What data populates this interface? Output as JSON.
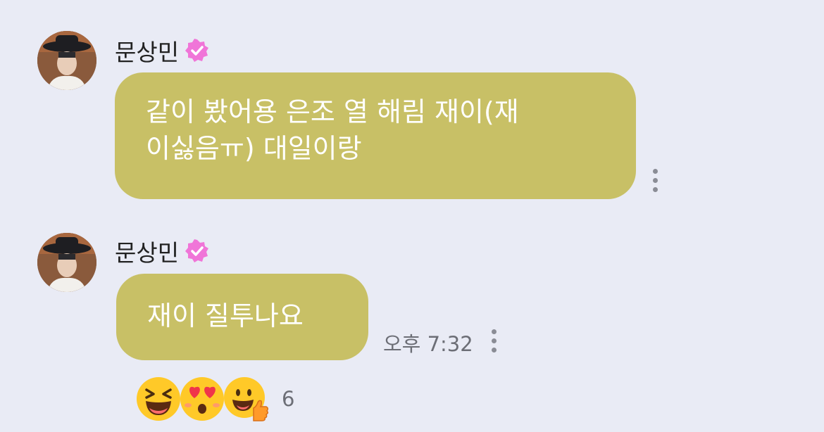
{
  "messages": [
    {
      "sender": "문상민",
      "text_lines": [
        "같이 봤어용 은조 열 해림 재이(재",
        "이싫음ㅠ) 대일이랑"
      ]
    },
    {
      "sender": "문상민",
      "text_lines": [
        "재이 질투나요"
      ],
      "time": "오후 7:32",
      "reactions": {
        "icons": [
          "laughing-emoji-icon",
          "heart-eyes-emoji-icon",
          "thumbs-up-emoji-icon"
        ],
        "count": "6"
      }
    }
  ],
  "colors": {
    "background": "#e9ebf5",
    "bubble": "#c8c066",
    "bubble_text": "#ffffff",
    "verified_badge": "#f075d8",
    "meta_text": "#6c6e76"
  }
}
